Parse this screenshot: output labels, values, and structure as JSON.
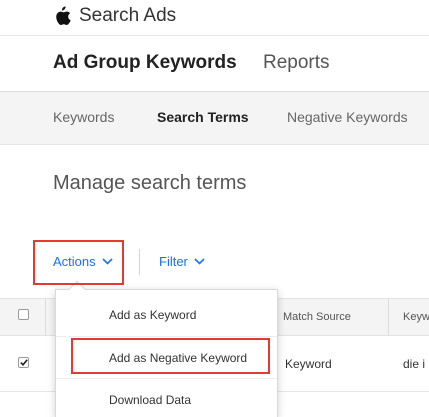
{
  "app": {
    "brand_name": "Search Ads"
  },
  "primary_nav": [
    {
      "label": "Ad Group Keywords",
      "active": true
    },
    {
      "label": "Reports",
      "active": false
    }
  ],
  "secondary_nav": [
    {
      "label": "Keywords",
      "active": false
    },
    {
      "label": "Search Terms",
      "active": true
    },
    {
      "label": "Negative Keywords",
      "active": false
    }
  ],
  "page": {
    "title": "Manage search terms"
  },
  "toolbar": {
    "actions_label": "Actions",
    "filter_label": "Filter"
  },
  "actions_menu": [
    {
      "label": "Add as Keyword"
    },
    {
      "label": "Add as Negative Keyword"
    },
    {
      "label": "Download Data"
    }
  ],
  "table": {
    "columns": [
      "Match Source",
      "Keyw"
    ],
    "rows": [
      {
        "checked": true,
        "match_source": "Keyword",
        "keyword": "die i"
      }
    ]
  },
  "colors": {
    "accent": "#1a73e8",
    "highlight": "#e53935"
  }
}
